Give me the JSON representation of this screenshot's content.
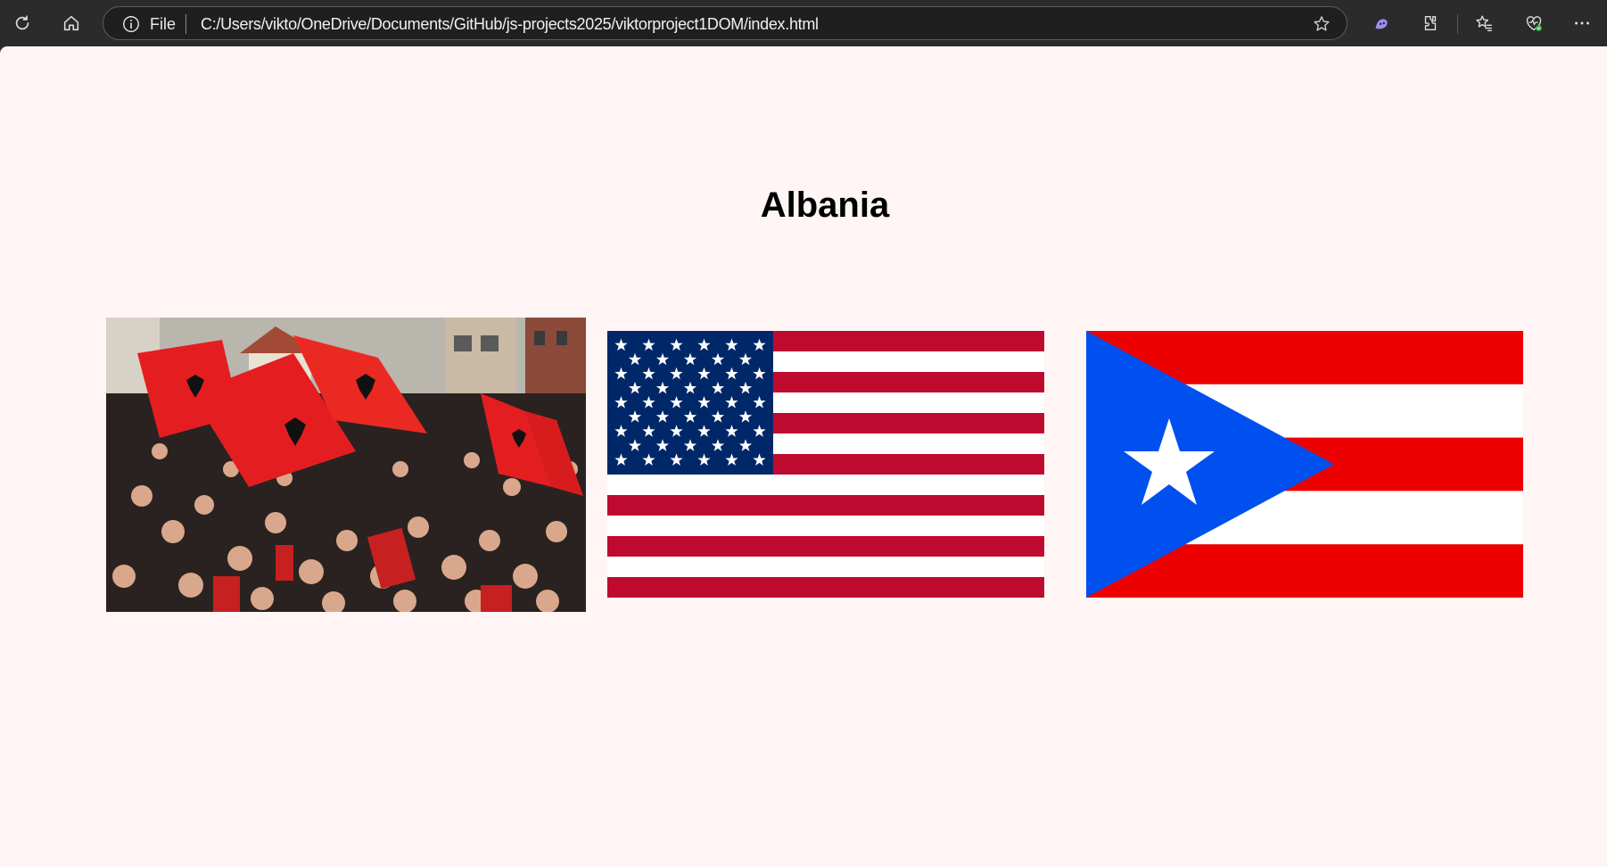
{
  "browser": {
    "scheme_label": "File",
    "url": "C:/Users/vikto/OneDrive/Documents/GitHub/js-projects2025/viktorproject1DOM/index.html",
    "icons": [
      "refresh-icon",
      "home-icon",
      "info-icon",
      "favorite-star-icon",
      "copilot-icon",
      "extensions-icon",
      "favorites-icon",
      "browser-essentials-icon",
      "more-icon"
    ]
  },
  "page": {
    "heading": "Albania",
    "images": [
      {
        "name": "albania-crowd-with-flags",
        "alt": "Crowd waving red Albanian flags"
      },
      {
        "name": "usa-flag",
        "alt": "Flag of the United States"
      },
      {
        "name": "puerto-rico-flag",
        "alt": "Flag of Puerto Rico"
      }
    ]
  },
  "colors": {
    "page_background": "#fff5f5",
    "toolbar_background": "#2b2b2b",
    "albania_red": "#e41e20",
    "usa_red": "#bf0a30",
    "usa_blue": "#002868",
    "pr_red": "#ed0000",
    "pr_blue": "#0050f0"
  }
}
